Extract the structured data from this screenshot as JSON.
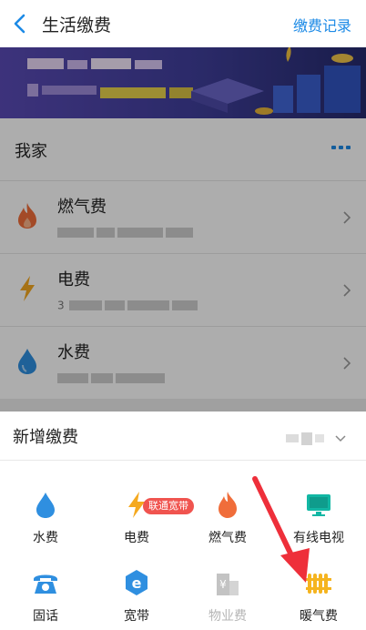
{
  "header": {
    "title": "生活缴费",
    "records_link": "缴费记录"
  },
  "home": {
    "title": "我家",
    "items": [
      {
        "name": "燃气费",
        "icon": "flame-icon"
      },
      {
        "name": "电费",
        "icon": "lightning-icon",
        "account_prefix": "3"
      },
      {
        "name": "水费",
        "icon": "water-drop-icon"
      }
    ]
  },
  "add": {
    "title": "新增缴费",
    "services": [
      {
        "label": "水费",
        "icon": "water-drop-icon",
        "color": "#2f8fe0"
      },
      {
        "label": "电费",
        "icon": "lightning-icon",
        "color": "#f5a91f"
      },
      {
        "label": "燃气费",
        "icon": "flame-icon",
        "color": "#f06d3a"
      },
      {
        "label": "有线电视",
        "icon": "tv-icon",
        "color": "#12b7a4"
      },
      {
        "label": "固话",
        "icon": "telephone-icon",
        "color": "#2f8fe0"
      },
      {
        "label": "宽带",
        "icon": "broadband-icon",
        "color": "#2f8fe0",
        "badge": "联通宽带"
      },
      {
        "label": "物业费",
        "icon": "building-icon",
        "color": "#bfbfbf"
      },
      {
        "label": "暖气费",
        "icon": "radiator-icon",
        "color": "#f5b41f"
      }
    ]
  },
  "colors": {
    "accent": "#1c8ae6",
    "badge": "#f0544f",
    "arrow": "#ee2f3a"
  }
}
